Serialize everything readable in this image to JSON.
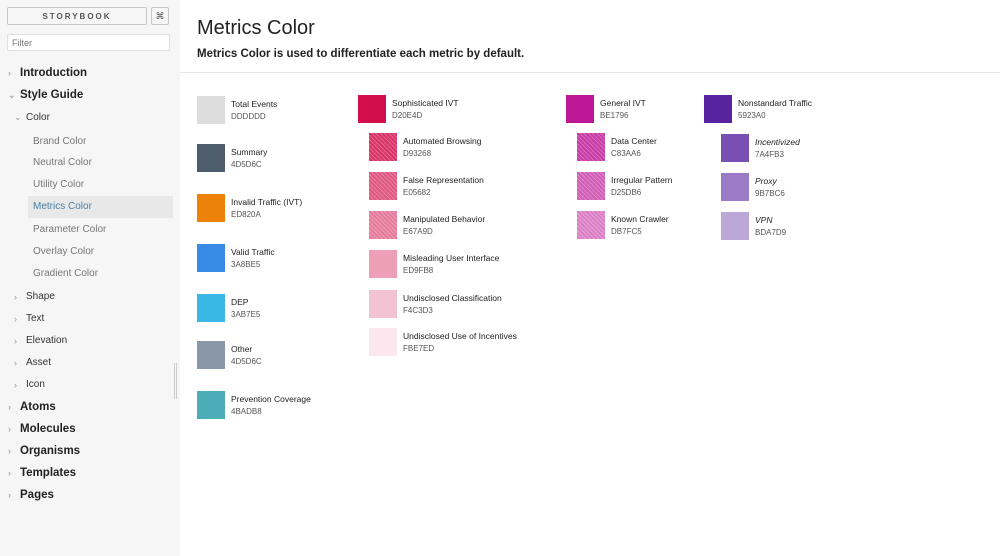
{
  "sidebar": {
    "brand": "STORYBOOK",
    "shortcut_icon": "⌘",
    "filter_placeholder": "Filter",
    "chevron_right": "›",
    "chevron_down": "⌄",
    "items": {
      "introduction": "Introduction",
      "style_guide": "Style Guide",
      "color": "Color",
      "brand_color": "Brand Color",
      "neutral_color": "Neutral Color",
      "utility_color": "Utility Color",
      "metrics_color": "Metrics Color",
      "parameter_color": "Parameter Color",
      "overlay_color": "Overlay Color",
      "gradient_color": "Gradient Color",
      "shape": "Shape",
      "text": "Text",
      "elevation": "Elevation",
      "asset": "Asset",
      "icon": "Icon",
      "atoms": "Atoms",
      "molecules": "Molecules",
      "organisms": "Organisms",
      "templates": "Templates",
      "pages": "Pages"
    }
  },
  "main": {
    "title": "Metrics Color",
    "subtitle": "Metrics Color is used to differentiate each metric by default."
  },
  "swatches": {
    "col1": [
      {
        "name": "Total Events",
        "hex": "DDDDDD",
        "color": "#DDDDDD"
      },
      {
        "name": "Summary",
        "hex": "4D5D6C",
        "color": "#4D5D6C"
      },
      {
        "name": "Invalid Traffic (IVT)",
        "hex": "ED820A",
        "color": "#ED820A"
      },
      {
        "name": "Valid Traffic",
        "hex": "3A8BE5",
        "color": "#3A8BE5"
      },
      {
        "name": "DEP",
        "hex": "3AB7E5",
        "color": "#3AB7E5"
      },
      {
        "name": "Other",
        "hex": "4D5D6C",
        "color": "#8A97A8"
      },
      {
        "name": "Prevention Coverage",
        "hex": "4BADB8",
        "color": "#4BADB8"
      }
    ],
    "col2": [
      {
        "name": "Sophisticated IVT",
        "hex": "D20E4D",
        "color": "#D20E4D"
      },
      {
        "name": "Automated Browsing",
        "hex": "D93268",
        "color": "#D93268"
      },
      {
        "name": "False Representation",
        "hex": "E05682",
        "color": "#E05682"
      },
      {
        "name": "Manipulated Behavior",
        "hex": "E67A9D",
        "color": "#E67A9D"
      },
      {
        "name": "Misleading User Interface",
        "hex": "ED9FB8",
        "color": "#ED9FB8"
      },
      {
        "name": "Undisclosed Classification",
        "hex": "F4C3D3",
        "color": "#F4C3D3"
      },
      {
        "name": "Undisclosed Use of Incentives",
        "hex": "FBE7ED",
        "color": "#FBE7ED"
      }
    ],
    "col3": [
      {
        "name": "General IVT",
        "hex": "BE1796",
        "color": "#BE1796"
      },
      {
        "name": "Data Center",
        "hex": "C83AA6",
        "color": "#C83AA6"
      },
      {
        "name": "Irregular Pattern",
        "hex": "D25DB6",
        "color": "#D25DB6"
      },
      {
        "name": "Known Crawler",
        "hex": "DB7FC5",
        "color": "#DB7FC5"
      }
    ],
    "col4": [
      {
        "name": "Nonstandard Traffic",
        "hex": "5923A0",
        "color": "#5923A0"
      },
      {
        "name": "Incentivized",
        "hex": "7A4FB3",
        "color": "#7A4FB3"
      },
      {
        "name": "Proxy",
        "hex": "9B7BC6",
        "color": "#9B7BC6"
      },
      {
        "name": "VPN",
        "hex": "BDA7D9",
        "color": "#BDA7D9"
      }
    ]
  }
}
